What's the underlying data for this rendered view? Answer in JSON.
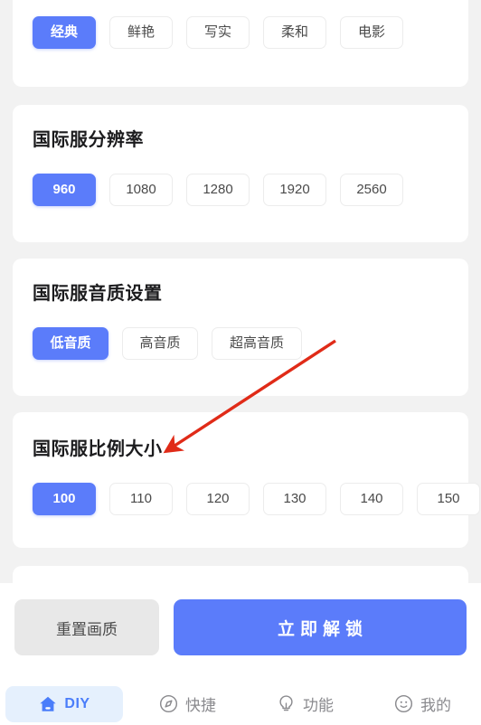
{
  "theme": {
    "accent": "#5b7cfa",
    "page_bg": "#f2f2f2",
    "card_bg": "#ffffff",
    "chip_border": "#ececec",
    "tab_active_bg": "#e5f0fd",
    "tab_active_fg": "#4a7dfa",
    "tab_inactive_fg": "#8a8a8e",
    "reset_bg": "#e8e8e8",
    "annotation": "#e02b18"
  },
  "sections": [
    {
      "id": "picture-style",
      "title": "",
      "selected": "经典",
      "options": [
        "经典",
        "鲜艳",
        "写实",
        "柔和",
        "电影"
      ]
    },
    {
      "id": "resolution",
      "title": "国际服分辨率",
      "selected": "960",
      "options": [
        "960",
        "1080",
        "1280",
        "1920",
        "2560"
      ]
    },
    {
      "id": "audio-quality",
      "title": "国际服音质设置",
      "selected": "低音质",
      "options": [
        "低音质",
        "高音质",
        "超高音质"
      ]
    },
    {
      "id": "scale-size",
      "title": "国际服比例大小",
      "selected": "100",
      "options": [
        "100",
        "110",
        "120",
        "130",
        "140",
        "150"
      ]
    }
  ],
  "actions": {
    "reset_label": "重置画质",
    "unlock_label": "立即解锁"
  },
  "tabs": [
    {
      "label": "DIY",
      "icon": "home-icon",
      "active": true
    },
    {
      "label": "快捷",
      "icon": "compass-icon",
      "active": false
    },
    {
      "label": "功能",
      "icon": "bulb-icon",
      "active": false
    },
    {
      "label": "我的",
      "icon": "face-icon",
      "active": false
    }
  ]
}
